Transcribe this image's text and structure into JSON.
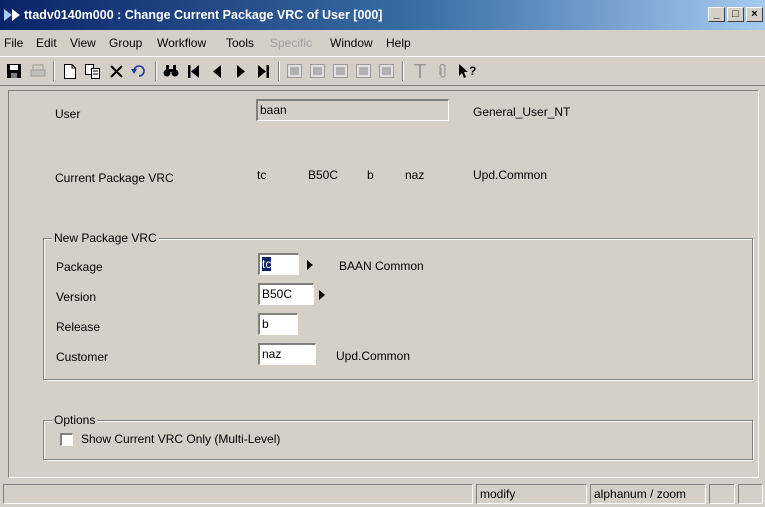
{
  "window": {
    "title": "ttadv0140m000 : Change Current Package VRC of User [000]",
    "minimize": "_",
    "maximize": "□",
    "close": "×"
  },
  "menu": [
    "File",
    "Edit",
    "View",
    "Group",
    "Workflow",
    "Tools",
    "Specific",
    "Window",
    "Help"
  ],
  "toolbar": {
    "icons": [
      "save-icon",
      "print-icon",
      "new-icon",
      "copy-icon",
      "delete-icon",
      "undo-icon",
      "find-icon",
      "first-record-icon",
      "previous-record-icon",
      "next-record-icon",
      "last-record-icon",
      "grid1-icon",
      "grid2-icon",
      "grid3-icon",
      "grid4-icon",
      "grid5-icon",
      "text-icon",
      "attachment-icon",
      "help-icon"
    ]
  },
  "form": {
    "user_label": "User",
    "user_value": "baan",
    "user_desc": "General_User_NT",
    "current_label": "Current Package VRC",
    "current_package": "tc",
    "current_version": "B50C",
    "current_release": "b",
    "current_customer": "naz",
    "current_desc": "Upd.Common",
    "new_group_title": "New Package VRC",
    "package_label": "Package",
    "package_value": "tc",
    "package_desc": "BAAN Common",
    "version_label": "Version",
    "version_value": "B50C",
    "release_label": "Release",
    "release_value": "b",
    "customer_label": "Customer",
    "customer_value": "naz",
    "customer_desc": "Upd.Common",
    "options_title": "Options",
    "show_current_label": "Show Current VRC Only (Multi-Level)",
    "show_current_checked": false
  },
  "status": {
    "panel1": "",
    "mode": "modify",
    "field_type": "alphanum / zoom",
    "panel4": "",
    "panel5": ""
  }
}
